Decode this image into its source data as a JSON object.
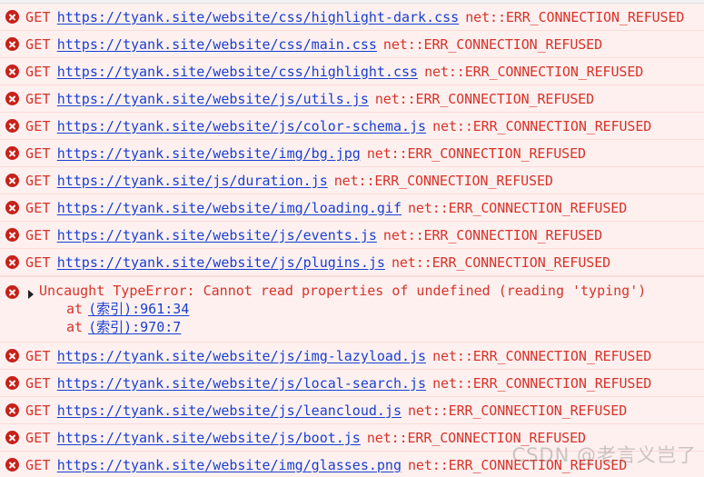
{
  "console": {
    "icons": {
      "error": "error-circle-x-icon",
      "disclosure": "triangle-right-icon"
    },
    "method_label": "GET",
    "network_error": "net::ERR_CONNECTION_REFUSED",
    "entries": [
      {
        "kind": "network",
        "method": "GET",
        "url": "https://tyank.site/website/css/highlight-dark.css",
        "status": "net::ERR_CONNECTION_REFUSED"
      },
      {
        "kind": "network",
        "method": "GET",
        "url": "https://tyank.site/website/css/main.css",
        "status": "net::ERR_CONNECTION_REFUSED"
      },
      {
        "kind": "network",
        "method": "GET",
        "url": "https://tyank.site/website/css/highlight.css",
        "status": "net::ERR_CONNECTION_REFUSED"
      },
      {
        "kind": "network",
        "method": "GET",
        "url": "https://tyank.site/website/js/utils.js",
        "status": "net::ERR_CONNECTION_REFUSED"
      },
      {
        "kind": "network",
        "method": "GET",
        "url": "https://tyank.site/website/js/color-schema.js",
        "status": "net::ERR_CONNECTION_REFUSED"
      },
      {
        "kind": "network",
        "method": "GET",
        "url": "https://tyank.site/website/img/bg.jpg",
        "status": "net::ERR_CONNECTION_REFUSED"
      },
      {
        "kind": "network",
        "method": "GET",
        "url": "https://tyank.site/js/duration.js",
        "status": "net::ERR_CONNECTION_REFUSED"
      },
      {
        "kind": "network",
        "method": "GET",
        "url": "https://tyank.site/website/img/loading.gif",
        "status": "net::ERR_CONNECTION_REFUSED"
      },
      {
        "kind": "network",
        "method": "GET",
        "url": "https://tyank.site/website/js/events.js",
        "status": "net::ERR_CONNECTION_REFUSED"
      },
      {
        "kind": "network",
        "method": "GET",
        "url": "https://tyank.site/website/js/plugins.js",
        "status": "net::ERR_CONNECTION_REFUSED"
      },
      {
        "kind": "exception",
        "message": "Uncaught TypeError: Cannot read properties of undefined (reading 'typing')",
        "stack": [
          {
            "at": "at",
            "link": "(索引):961:34"
          },
          {
            "at": "at",
            "link": "(索引):970:7"
          }
        ]
      },
      {
        "kind": "network",
        "method": "GET",
        "url": "https://tyank.site/website/js/img-lazyload.js",
        "status": "net::ERR_CONNECTION_REFUSED"
      },
      {
        "kind": "network",
        "method": "GET",
        "url": "https://tyank.site/website/js/local-search.js",
        "status": "net::ERR_CONNECTION_REFUSED"
      },
      {
        "kind": "network",
        "method": "GET",
        "url": "https://tyank.site/website/js/leancloud.js",
        "status": "net::ERR_CONNECTION_REFUSED"
      },
      {
        "kind": "network",
        "method": "GET",
        "url": "https://tyank.site/website/js/boot.js",
        "status": "net::ERR_CONNECTION_REFUSED"
      },
      {
        "kind": "network",
        "method": "GET",
        "url": "https://tyank.site/website/img/glasses.png",
        "status": "net::ERR_CONNECTION_REFUSED"
      }
    ]
  },
  "watermark": {
    "text": "CSDN @老言义岂了"
  },
  "colors": {
    "error_background": "#fdf0ef",
    "error_text": "#d8332a",
    "link": "#1a3fd0",
    "icon_red": "#c7211a",
    "row_divider": "#fbdbd8"
  }
}
